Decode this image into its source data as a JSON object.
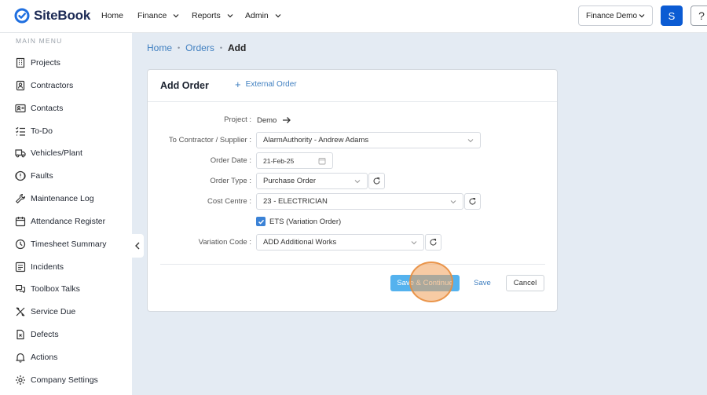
{
  "app": {
    "name": "SiteBook"
  },
  "nav": {
    "home": "Home",
    "finance": "Finance",
    "reports": "Reports",
    "admin": "Admin"
  },
  "topbar": {
    "environment": "Finance Demo",
    "avatar_initial": "S",
    "help": "?"
  },
  "sidebar": {
    "title": "MAIN MENU",
    "items": [
      {
        "label": "Projects",
        "icon": "building-icon"
      },
      {
        "label": "Contractors",
        "icon": "hard-hat-icon"
      },
      {
        "label": "Contacts",
        "icon": "contact-card-icon"
      },
      {
        "label": "To-Do",
        "icon": "checklist-icon"
      },
      {
        "label": "Vehicles/Plant",
        "icon": "truck-icon"
      },
      {
        "label": "Faults",
        "icon": "alert-circle-icon"
      },
      {
        "label": "Maintenance Log",
        "icon": "wrench-icon"
      },
      {
        "label": "Attendance Register",
        "icon": "calendar-icon"
      },
      {
        "label": "Timesheet Summary",
        "icon": "clock-icon"
      },
      {
        "label": "Incidents",
        "icon": "incident-icon"
      },
      {
        "label": "Toolbox Talks",
        "icon": "chat-bubbles-icon"
      },
      {
        "label": "Service Due",
        "icon": "tools-icon"
      },
      {
        "label": "Defects",
        "icon": "document-x-icon"
      },
      {
        "label": "Actions",
        "icon": "bell-icon"
      },
      {
        "label": "Company Settings",
        "icon": "gear-icon"
      }
    ]
  },
  "breadcrumb": {
    "home": "Home",
    "orders": "Orders",
    "current": "Add"
  },
  "card": {
    "title": "Add Order",
    "external_link": "External Order",
    "fields": {
      "project_label": "Project :",
      "project_value": "Demo",
      "contractor_label": "To Contractor / Supplier :",
      "contractor_value": "AlarmAuthority - Andrew Adams",
      "date_label": "Order Date :",
      "date_value": "21-Feb-25",
      "type_label": "Order Type :",
      "type_value": "Purchase Order",
      "cost_label": "Cost Centre :",
      "cost_value": "23 - ELECTRICIAN",
      "ets_label": "ETS (Variation Order)",
      "ets_checked": true,
      "variation_label": "Variation Code :",
      "variation_value": "ADD Additional Works"
    },
    "buttons": {
      "save_continue": "Save & Continue",
      "save": "Save",
      "cancel": "Cancel"
    }
  },
  "colors": {
    "primary": "#0b5bd3",
    "link": "#3f7fc0",
    "accent_button": "#54b2ee",
    "background": "#e4ebf3",
    "logo_text": "#1c2a55"
  }
}
